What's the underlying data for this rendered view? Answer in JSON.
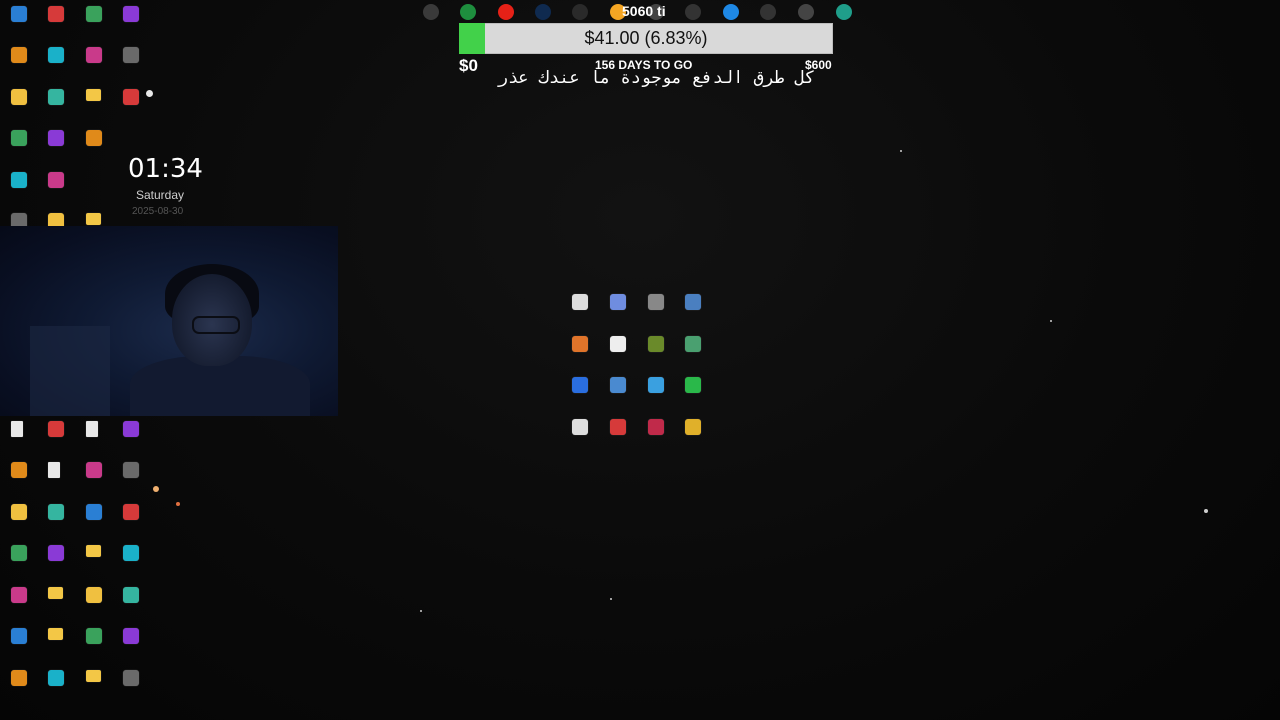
{
  "goal": {
    "amount_text": "$41.00 (6.83%)",
    "progress_percent": 6.83,
    "min_label": "$0",
    "max_label": "$600",
    "days_label": "156 DAYS TO GO"
  },
  "overlay_text": "كل طرق الدفع موجودة ما عندك عذر",
  "clock": {
    "time": "01:34",
    "day": "Saturday",
    "date": "2025-08-30"
  },
  "top_label": "5060 ti",
  "colors": {
    "progress_fill": "#42d14a",
    "progress_track": "#d9d9d9",
    "background": "#0a0a0a"
  },
  "top_icons": [
    {
      "name": "steam-icon",
      "color": "#3a3a3a"
    },
    {
      "name": "google-drive-icon",
      "color": "#1e8e3e"
    },
    {
      "name": "youtube-icon",
      "color": "#e62117"
    },
    {
      "name": "photoshop-icon",
      "color": "#0f2a4f"
    },
    {
      "name": "epic-games-icon",
      "color": "#2a2a2a"
    },
    {
      "name": "rockstar-icon",
      "color": "#f5a623"
    },
    {
      "name": "app-icon",
      "color": "#444"
    },
    {
      "name": "app-icon",
      "color": "#333"
    },
    {
      "name": "edge-icon",
      "color": "#1e88e5"
    },
    {
      "name": "app-icon",
      "color": "#333"
    },
    {
      "name": "app-icon",
      "color": "#444"
    },
    {
      "name": "discord-icon",
      "color": "#1f9e8a"
    },
    {
      "name": "spotify-icon",
      "color": "#1db954"
    }
  ]
}
